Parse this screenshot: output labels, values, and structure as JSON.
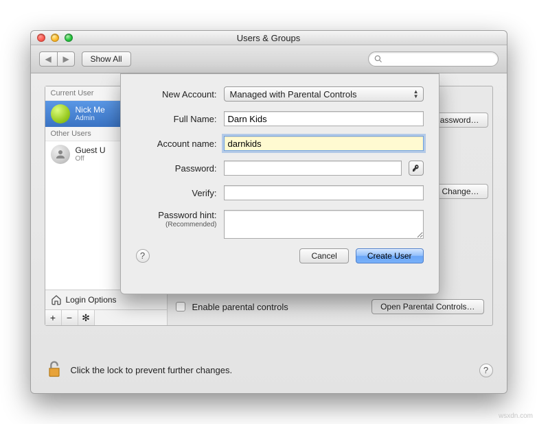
{
  "window": {
    "title": "Users & Groups"
  },
  "toolbar": {
    "show_all_label": "Show All",
    "search_placeholder": ""
  },
  "sidebar": {
    "current_header": "Current User",
    "other_header": "Other Users",
    "current": {
      "name": "Nick Me",
      "role": "Admin"
    },
    "other": {
      "name": "Guest U",
      "role": "Off"
    },
    "login_options_label": "Login Options"
  },
  "main_panel": {
    "change_password_label": "Change Password…",
    "change_label": "Change…",
    "enable_parental_label": "Enable parental controls",
    "open_parental_label": "Open Parental Controls…"
  },
  "lock_row": {
    "text": "Click the lock to prevent further changes."
  },
  "sheet": {
    "new_account_label": "New Account:",
    "new_account_value": "Managed with Parental Controls",
    "full_name_label": "Full Name:",
    "full_name_value": "Darn Kids",
    "account_name_label": "Account name:",
    "account_name_value": "darnkids",
    "password_label": "Password:",
    "password_value": "",
    "verify_label": "Verify:",
    "verify_value": "",
    "hint_label": "Password hint:",
    "hint_rec": "(Recommended)",
    "hint_value": "",
    "cancel_label": "Cancel",
    "create_label": "Create User"
  },
  "watermark": "wsxdn.com"
}
